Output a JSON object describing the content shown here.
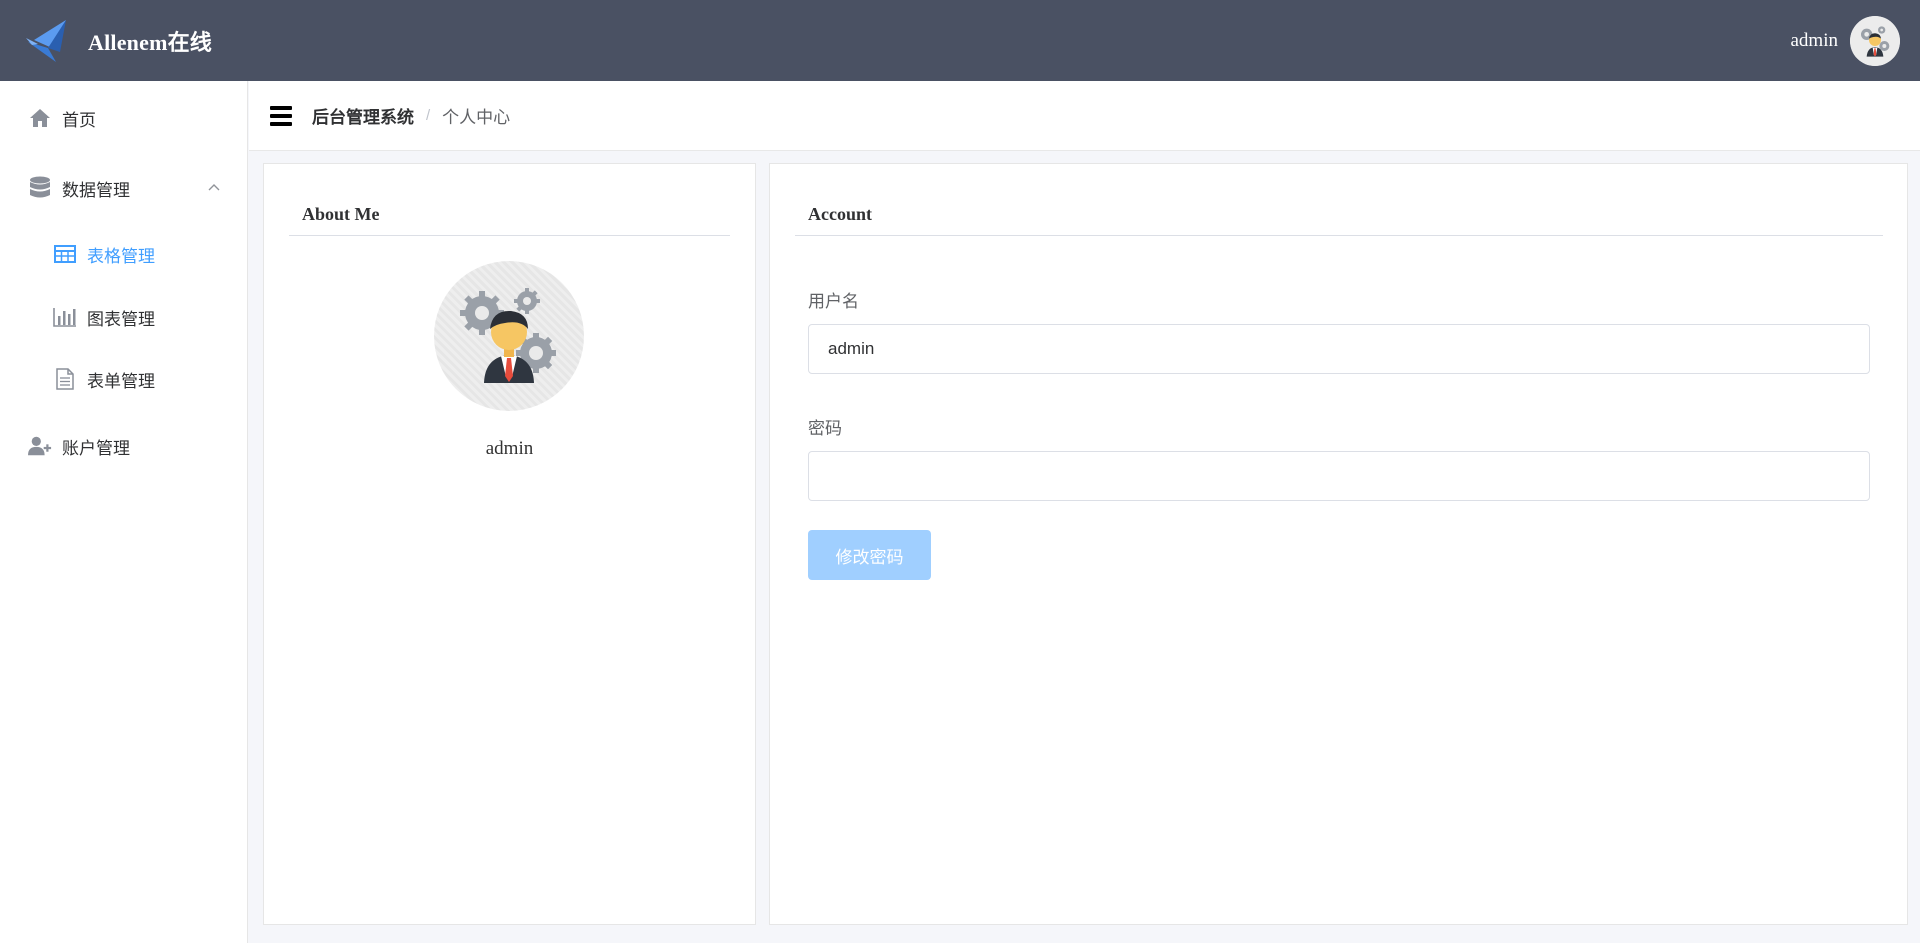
{
  "header": {
    "brand": "Allenem在线",
    "username": "admin",
    "logo_icon": "bird-logo-icon",
    "avatar_icon": "businessman-gears-avatar"
  },
  "sidebar": {
    "items": [
      {
        "label": "首页",
        "icon": "home-icon"
      },
      {
        "label": "数据管理",
        "icon": "database-icon",
        "expanded": true,
        "children": [
          {
            "label": "表格管理",
            "icon": "table-icon",
            "active": true
          },
          {
            "label": "图表管理",
            "icon": "bar-chart-icon"
          },
          {
            "label": "表单管理",
            "icon": "document-icon"
          }
        ]
      },
      {
        "label": "账户管理",
        "icon": "user-plus-icon"
      }
    ]
  },
  "breadcrumb": {
    "root": "后台管理系统",
    "separator": "/",
    "current": "个人中心"
  },
  "about": {
    "title": "About Me",
    "name": "admin"
  },
  "account": {
    "title": "Account",
    "username_label": "用户名",
    "username_value": "admin",
    "password_label": "密码",
    "password_value": "",
    "submit_label": "修改密码"
  },
  "colors": {
    "header_bg": "#4a5163",
    "accent": "#409eff",
    "button_disabled": "#a0cfff"
  }
}
